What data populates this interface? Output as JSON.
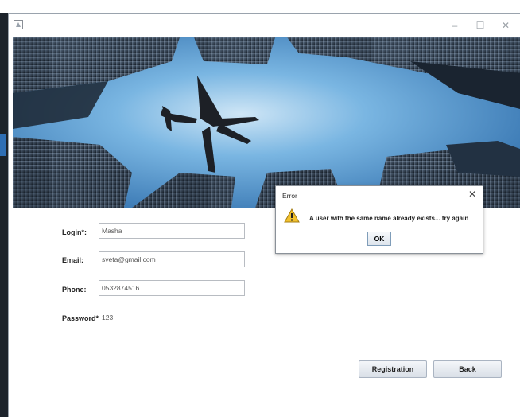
{
  "window": {
    "minimize_glyph": "–",
    "maximize_glyph": "☐",
    "close_glyph": "✕"
  },
  "form": {
    "login": {
      "label": "Login*:",
      "value": "Masha"
    },
    "email": {
      "label": "Email:",
      "value": "sveta@gmail.com"
    },
    "phone": {
      "label": "Phone:",
      "value": "0532874516"
    },
    "password": {
      "label": "Password*:",
      "value": "123"
    }
  },
  "buttons": {
    "registration": "Registration",
    "back": "Back"
  },
  "dialog": {
    "title": "Error",
    "close_glyph": "✕",
    "message": "A user with the same name already exists... try again",
    "ok": "OK",
    "icon": "warning-icon"
  },
  "colors": {
    "sky": "#3f8ed0",
    "building": "#1e2833",
    "warning": "#f2c12e"
  }
}
